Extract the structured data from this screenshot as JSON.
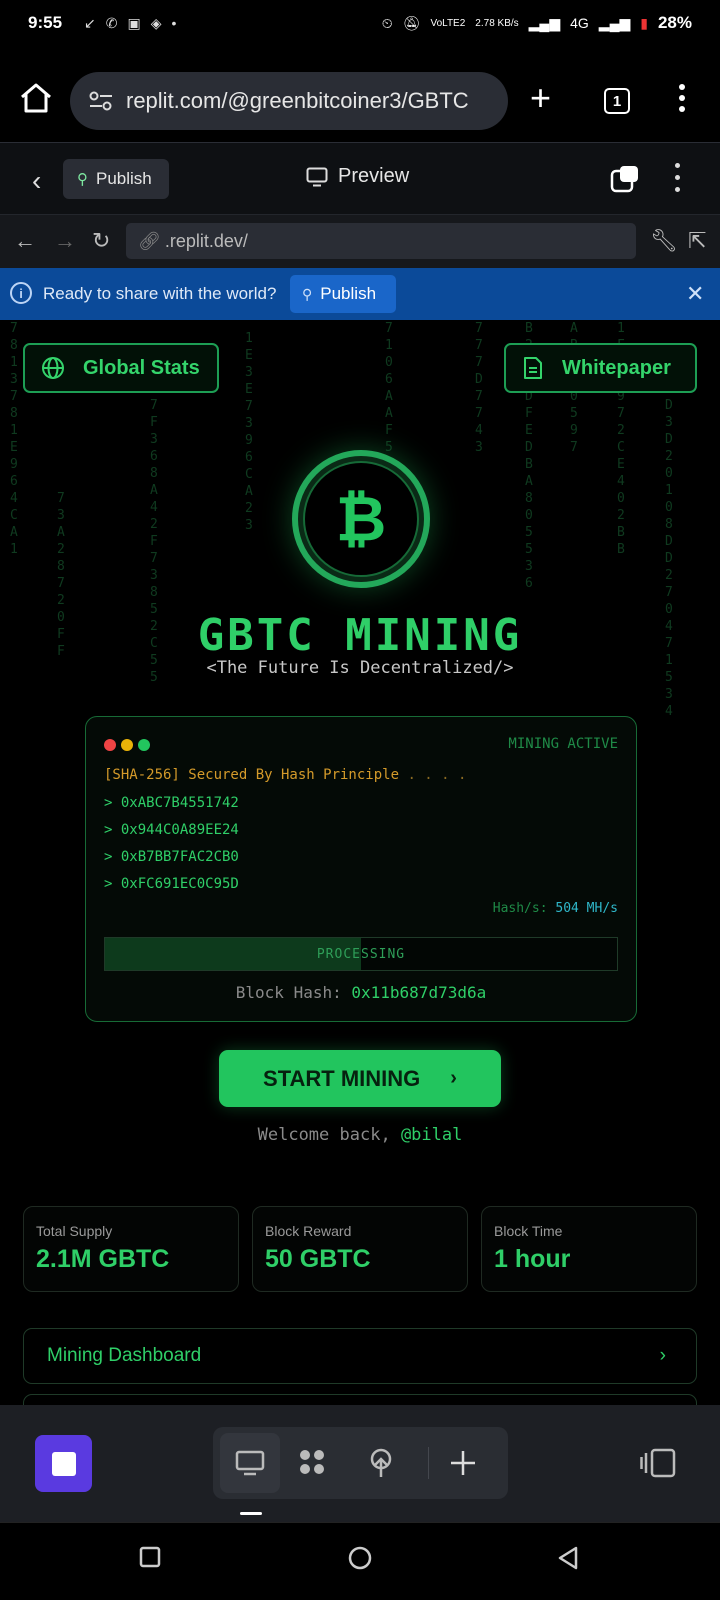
{
  "status_bar": {
    "time": "9:55",
    "net_speed": "2.78 KB/s",
    "volte": "VoLTE2",
    "network": "4G",
    "battery": "28%"
  },
  "browser": {
    "url": "replit.com/@greenbitcoiner3/GBTC",
    "tab_count": "1"
  },
  "replit_header": {
    "publish_label": "Publish",
    "preview_label": "Preview"
  },
  "preview_nav": {
    "url": ".replit.dev/"
  },
  "banner": {
    "text": "Ready to share with the world?",
    "publish_label": "Publish"
  },
  "app": {
    "global_stats_label": "Global Stats",
    "whitepaper_label": "Whitepaper",
    "coin_symbol": "₿",
    "title": "GBTC MINING",
    "subtitle": "<The Future Is Decentralized/>",
    "terminal": {
      "status": "MINING ACTIVE",
      "sha_line": "[SHA-256] Secured By Hash Principle",
      "sha_dots": ". . . .",
      "hashes": [
        "> 0xABC7B4551742",
        "> 0x944C0A89EE24",
        "> 0xB7BB7FAC2CB0",
        "> 0xFC691EC0C95D"
      ],
      "hashrate_label": "Hash/s:",
      "hashrate_value": "504 MH/s",
      "progress_label": "PROCESSING",
      "progress_fraction": 0.5,
      "block_hash_label": "Block Hash:",
      "block_hash_value": "0x11b687d73d6a"
    },
    "start_button_label": "START MINING",
    "welcome_prefix": "Welcome back,",
    "username": "@bilal",
    "stats": [
      {
        "label": "Total Supply",
        "value": "2.1M GBTC"
      },
      {
        "label": "Block Reward",
        "value": "50 GBTC"
      },
      {
        "label": "Block Time",
        "value": "1 hour"
      }
    ],
    "dashboard_label": "Mining Dashboard"
  },
  "colors": {
    "accent_green": "#22c55e",
    "banner_blue": "#0b4a99",
    "app_icon_purple": "#5a3ae0"
  }
}
